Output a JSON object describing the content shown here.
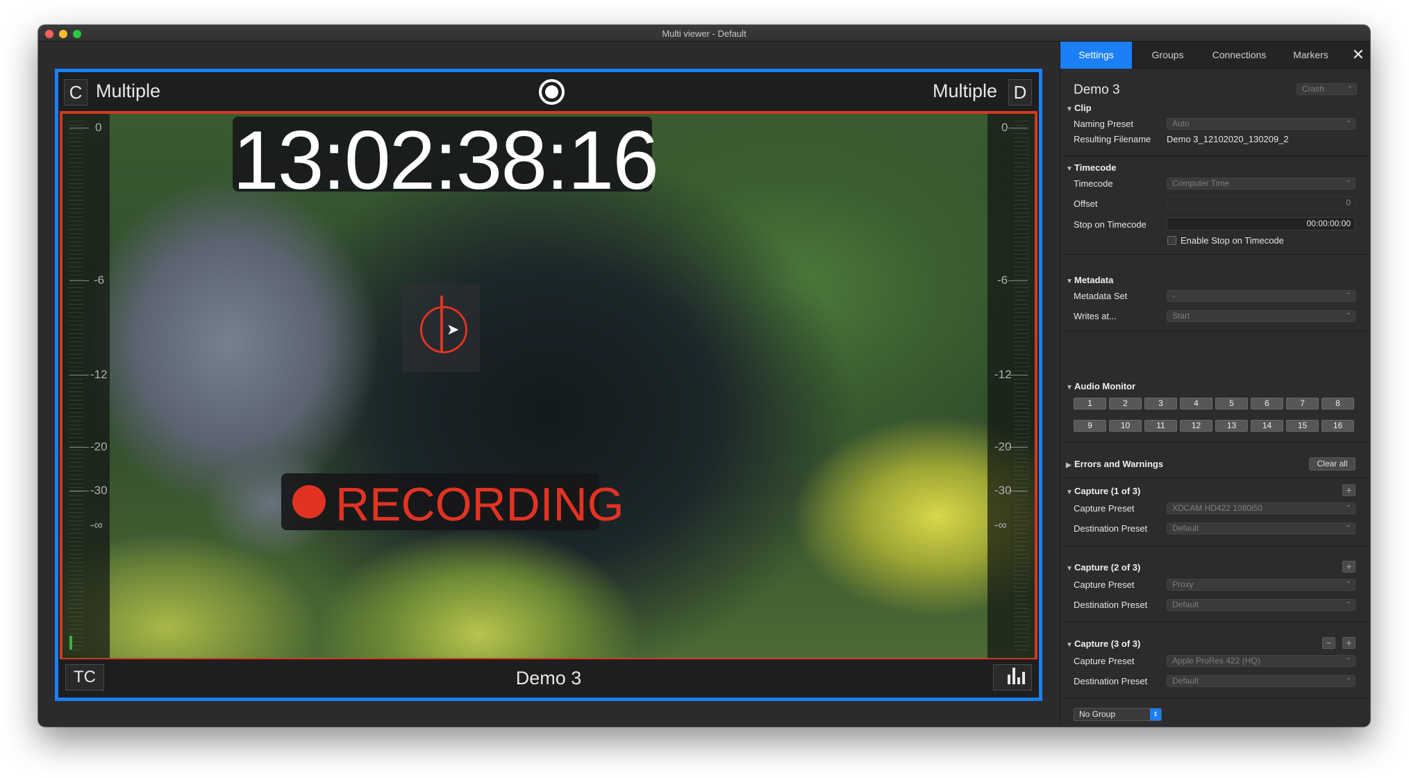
{
  "window": {
    "title": "Multi viewer - Default"
  },
  "viewer": {
    "left_box": "C",
    "left_label": "Multiple",
    "right_label": "Multiple",
    "right_box": "D",
    "timecode": "13:02:38:16",
    "recording_label": "RECORDING",
    "tc_button": "TC",
    "source_name": "Demo 3",
    "meter_ticks": [
      "0",
      "-6",
      "-12",
      "-20",
      "-30",
      "-∞"
    ]
  },
  "panel": {
    "tabs": [
      {
        "label": "Settings",
        "active": true
      },
      {
        "label": "Groups",
        "active": false
      },
      {
        "label": "Connections",
        "active": false
      },
      {
        "label": "Markers",
        "active": false
      }
    ],
    "title": "Demo 3",
    "crash_label": "Crash",
    "clip": {
      "heading": "Clip",
      "naming_preset_label": "Naming Preset",
      "naming_preset_value": "Auto",
      "resulting_filename_label": "Resulting Filename",
      "resulting_filename_value": "Demo 3_12102020_130209_2"
    },
    "timecode": {
      "heading": "Timecode",
      "timecode_label": "Timecode",
      "timecode_value": "Computer Time",
      "offset_label": "Offset",
      "offset_value": "0",
      "stop_label": "Stop on Timecode",
      "stop_value": "00:00:00:00",
      "enable_stop_label": "Enable Stop on Timecode"
    },
    "metadata": {
      "heading": "Metadata",
      "set_label": "Metadata Set",
      "set_value": "-",
      "writes_label": "Writes at...",
      "writes_value": "Start"
    },
    "audio_monitor": {
      "heading": "Audio Monitor",
      "channels_row1": [
        "1",
        "2",
        "3",
        "4",
        "5",
        "6",
        "7",
        "8"
      ],
      "channels_row2": [
        "9",
        "10",
        "11",
        "12",
        "13",
        "14",
        "15",
        "16"
      ]
    },
    "errors": {
      "heading": "Errors and Warnings",
      "clear_label": "Clear all"
    },
    "captures": [
      {
        "heading": "Capture (1 of 3)",
        "capture_label": "Capture Preset",
        "capture_value": "XDCAM HD422 1080i50",
        "dest_label": "Destination Preset",
        "dest_value": "Default"
      },
      {
        "heading": "Capture (2 of 3)",
        "capture_label": "Capture Preset",
        "capture_value": "Proxy",
        "dest_label": "Destination Preset",
        "dest_value": "Default"
      },
      {
        "heading": "Capture (3 of 3)",
        "capture_label": "Capture Preset",
        "capture_value": "Apple ProRes 422 (HQ)",
        "dest_label": "Destination Preset",
        "dest_value": "Default"
      }
    ],
    "group_select": "No Group"
  },
  "colors": {
    "accent": "#1b7ff5",
    "recording": "#e23322",
    "viewer_border": "#1b7ff5",
    "video_border": "#d33a20"
  }
}
